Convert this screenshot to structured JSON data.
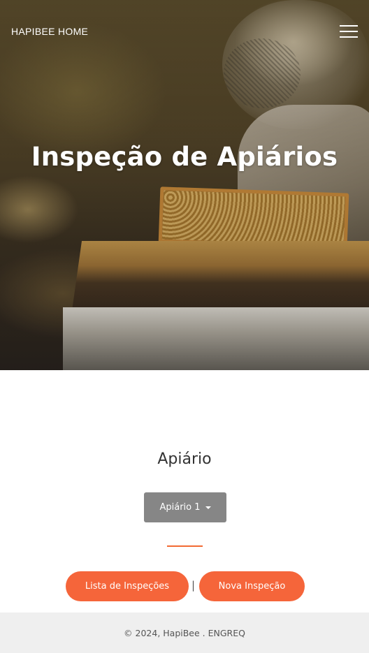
{
  "header": {
    "brand": "HAPIBEE HOME",
    "menu_icon": "hamburger-menu-icon"
  },
  "hero": {
    "title": "Inspeção de Apiários"
  },
  "main": {
    "section_title": "Apiário",
    "dropdown": {
      "selected": "Apiário 1",
      "icon": "caret-down-icon"
    },
    "actions": {
      "list_label": "Lista de Inspeções",
      "separator": "|",
      "new_label": "Nova Inspeção"
    }
  },
  "footer": {
    "text": "© 2024, HapiBee . ENGREQ"
  },
  "colors": {
    "accent": "#f5653a",
    "dropdown_bg": "#868686",
    "footer_bg": "#efefef"
  }
}
